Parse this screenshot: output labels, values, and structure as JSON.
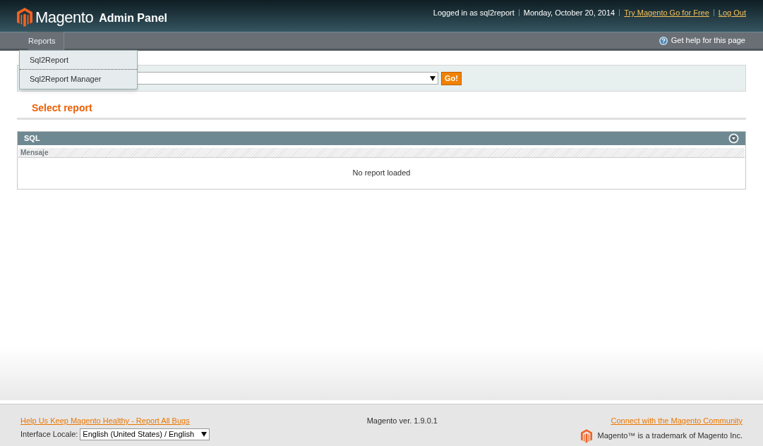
{
  "header": {
    "logo_text": "Magento",
    "logo_suffix": "Admin Panel",
    "user": "Logged in as sql2report",
    "date": "Monday, October 20, 2014",
    "links": [
      "Try Magento Go for Free",
      "Log Out"
    ]
  },
  "nav": {
    "items": [
      {
        "label": "Reports",
        "expanded": true,
        "children": [
          {
            "label": "Sql2Report"
          },
          {
            "label": "Sql2Report Manager"
          }
        ]
      }
    ],
    "help": "Get help for this page"
  },
  "filter": {
    "button": "Go!"
  },
  "title": "Select report",
  "panel": {
    "title": "SQL",
    "column": "Mensaje",
    "message": "No report loaded"
  },
  "footer": {
    "bug_link": "Help Us Keep Magento Healthy - Report All Bugs",
    "locale_label": "Interface Locale:",
    "locale_value": "English (United States) / English",
    "version": "Magento ver. 1.9.0.1",
    "community_link": "Connect with the Magento Community",
    "trademark": "Magento™ is a trademark of Magento Inc."
  }
}
